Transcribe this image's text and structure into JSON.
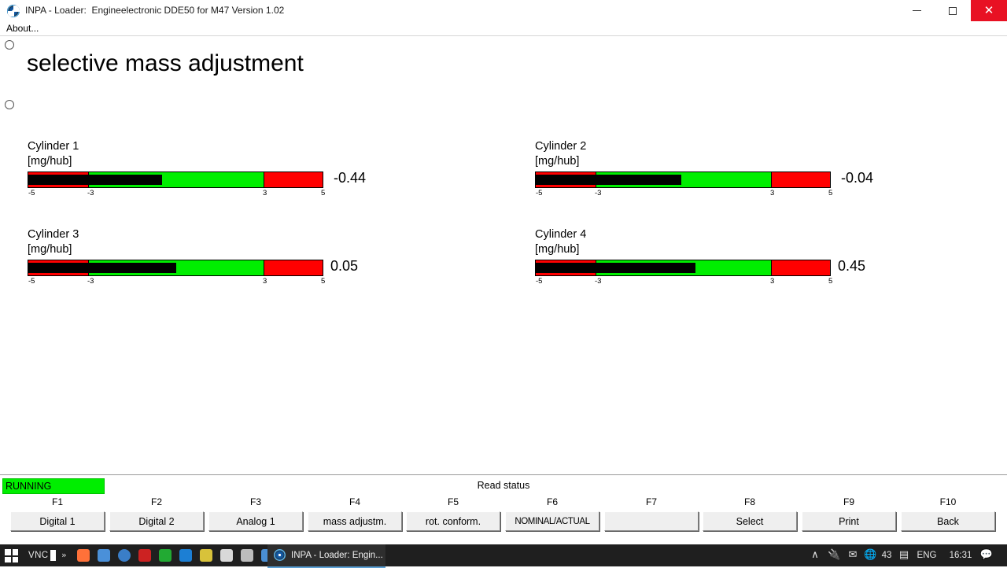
{
  "window": {
    "title": "INPA - Loader:  Engineelectronic DDE50 for M47 Version 1.02",
    "icon": "bmw-logo-icon",
    "minimize_label": "–",
    "maximize_label": "□",
    "close_label": "✕"
  },
  "menu": {
    "about_label": "About..."
  },
  "screen": {
    "title": "selective mass adjustment"
  },
  "chart_data": {
    "type": "bar",
    "title": "selective mass adjustment",
    "xlabel": "",
    "ylabel": "[mg/hub]",
    "xlim": [
      -5,
      5
    ],
    "grid": false,
    "legend": "none",
    "tick_labels": [
      "-5",
      "-3",
      "3",
      "5"
    ],
    "tick_values": [
      -5,
      -3,
      3,
      5
    ],
    "zones": [
      {
        "from": -5,
        "to": -3,
        "color": "#ff0000"
      },
      {
        "from": -3,
        "to": 3,
        "color": "#00ee00"
      },
      {
        "from": 3,
        "to": 5,
        "color": "#ff0000"
      }
    ],
    "categories": [
      "Cylinder 1",
      "Cylinder 2",
      "Cylinder 3",
      "Cylinder 4"
    ],
    "values": [
      -0.44,
      -0.04,
      0.05,
      0.45
    ]
  },
  "gauges": [
    {
      "name": "Cylinder 1",
      "unit": "[mg/hub]",
      "value": "-0.44",
      "value_num": -0.44,
      "ticks": [
        "-5",
        "-3",
        "3",
        "5"
      ]
    },
    {
      "name": "Cylinder 2",
      "unit": "[mg/hub]",
      "value": "-0.04",
      "value_num": -0.04,
      "ticks": [
        "-5",
        "-3",
        "3",
        "5"
      ]
    },
    {
      "name": "Cylinder 3",
      "unit": "[mg/hub]",
      "value": "0.05",
      "value_num": 0.05,
      "ticks": [
        "-5",
        "-3",
        "3",
        "5"
      ]
    },
    {
      "name": "Cylinder 4",
      "unit": "[mg/hub]",
      "value": "0.45",
      "value_num": 0.45,
      "ticks": [
        "-5",
        "-3",
        "3",
        "5"
      ]
    }
  ],
  "status": {
    "running_label": "RUNNING",
    "running_color": "#00ee00",
    "read_status_label": "Read status"
  },
  "fkeys": [
    {
      "key": "F1",
      "label": "Digital 1"
    },
    {
      "key": "F2",
      "label": "Digital 2"
    },
    {
      "key": "F3",
      "label": "Analog 1"
    },
    {
      "key": "F4",
      "label": "mass adjustm."
    },
    {
      "key": "F5",
      "label": "rot. conform."
    },
    {
      "key": "F6",
      "label": "NOMINAL/ACTUAL"
    },
    {
      "key": "F7",
      "label": ""
    },
    {
      "key": "F8",
      "label": "Select"
    },
    {
      "key": "F9",
      "label": "Print"
    },
    {
      "key": "F10",
      "label": "Back"
    }
  ],
  "taskbar": {
    "start_icon": "windows-start-icon",
    "vnc_label": "VNC",
    "overflow_label": "»",
    "apps": [
      {
        "name": "firefox-icon",
        "color": "#ff7139"
      },
      {
        "name": "mail-icon",
        "color": "#4a90d9"
      },
      {
        "name": "browser-icon",
        "color": "#3a7ec8"
      },
      {
        "name": "autocad-icon",
        "color": "#cc2222"
      },
      {
        "name": "terminal-icon",
        "color": "#22aa33"
      },
      {
        "name": "teamviewer-icon",
        "color": "#1c7fd4"
      },
      {
        "name": "pencil-icon",
        "color": "#d8c23a"
      },
      {
        "name": "notepad-icon",
        "color": "#d9d9d9"
      },
      {
        "name": "calculator-icon",
        "color": "#bcbcbc"
      },
      {
        "name": "save-icon",
        "color": "#4a8fd4"
      }
    ],
    "active_task": {
      "icon": "bmw-logo-icon",
      "label": "INPA - Loader:  Engin..."
    },
    "tray": {
      "expand_label": "∧",
      "usb_label": "usb-icon",
      "mail_label": "envelope-icon",
      "network_label": "globe-offline-icon",
      "count": "43",
      "battery_label": "battery-icon",
      "language": "ENG",
      "time": "16:31",
      "action_center": "notification-icon"
    }
  }
}
